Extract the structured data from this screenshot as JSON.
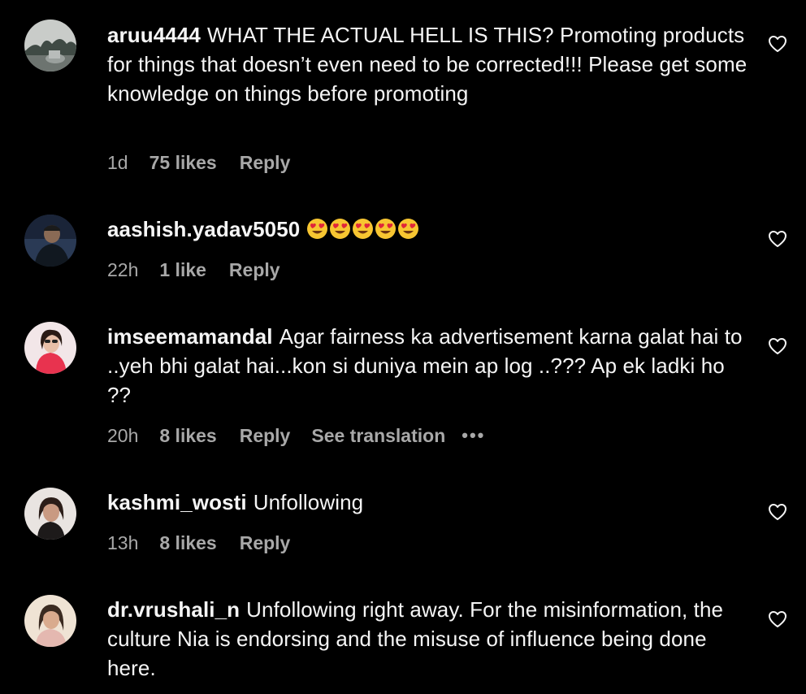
{
  "comments": [
    {
      "username": "aruu4444",
      "text": "WHAT THE ACTUAL HELL IS THIS? Promoting products for things that doesn’t even need to be corrected!!! Please get some knowledge on things before promoting",
      "time": "1d",
      "likes": "75 likes",
      "reply": "Reply"
    },
    {
      "username": "aashish.yadav5050",
      "emoji": "😍😍😍😍😍",
      "time": "22h",
      "likes": "1 like",
      "reply": "Reply"
    },
    {
      "username": "imseemamandal",
      "text": "Agar fairness ka advertisement karna galat hai to ..yeh bhi galat hai...kon si duniya mein ap log ..??? Ap ek ladki ho ??",
      "time": "20h",
      "likes": "8 likes",
      "reply": "Reply",
      "see_translation": "See translation",
      "more": "•••"
    },
    {
      "username": "kashmi_wosti",
      "text": "Unfollowing",
      "time": "13h",
      "likes": "8 likes",
      "reply": "Reply"
    },
    {
      "username": "dr.vrushali_n",
      "text": "Unfollowing right away. For the misinformation, the culture Nia is endorsing and the misuse of influence being done here."
    }
  ],
  "icons": {
    "heart": "heart-outline-icon"
  },
  "colors": {
    "background": "#000000",
    "text": "#f5f5f5",
    "secondary": "#a8a8a8"
  }
}
